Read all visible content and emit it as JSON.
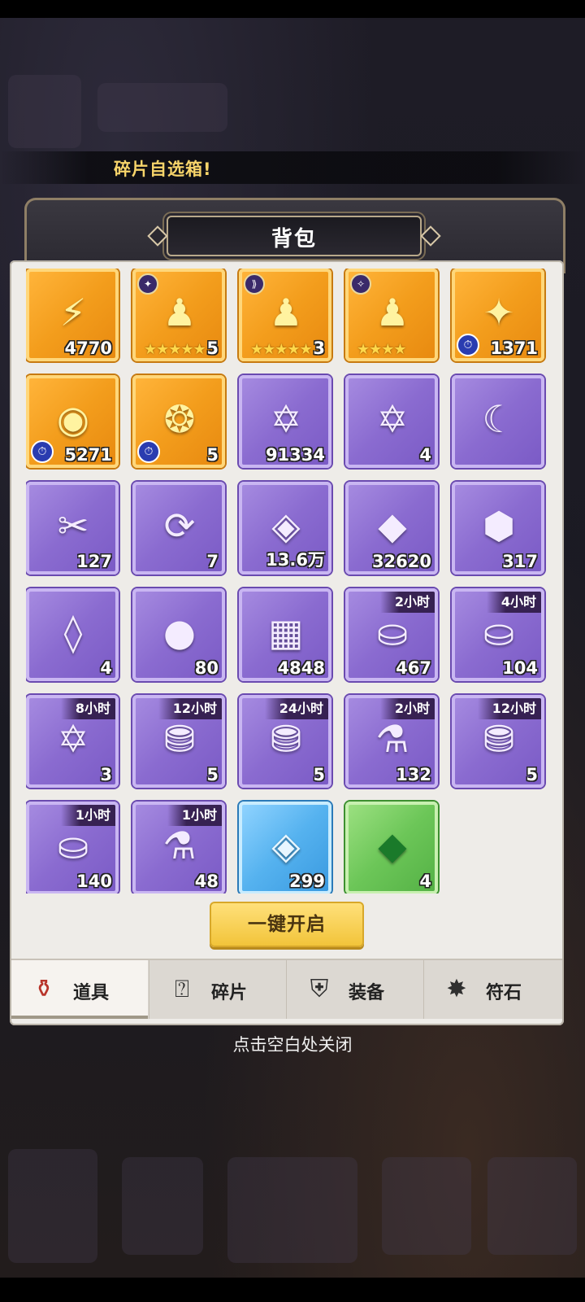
{
  "marquee_text": "碎片自选箱!",
  "panel": {
    "title": "背包"
  },
  "items": [
    {
      "rarity": "gold",
      "icon": "yellow-crystal-icon",
      "glyph": "⚡",
      "count": "4770"
    },
    {
      "rarity": "gold",
      "icon": "hero-figure-icon",
      "glyph": "♟",
      "count": "5",
      "stars": "★★★★★",
      "badge": "✦"
    },
    {
      "rarity": "gold",
      "icon": "hero-figure-icon",
      "glyph": "♟",
      "count": "3",
      "stars": "★★★★★",
      "badge": "⟫"
    },
    {
      "rarity": "gold",
      "icon": "hero-figure-icon",
      "glyph": "♟",
      "count": "",
      "stars": "★★★★",
      "badge": "✧"
    },
    {
      "rarity": "gold",
      "icon": "star-emblem-icon",
      "glyph": "✦",
      "count": "1371",
      "timer": true
    },
    {
      "rarity": "gold",
      "icon": "crystal-ball-icon",
      "glyph": "◉",
      "count": "5271",
      "timer": true
    },
    {
      "rarity": "gold",
      "icon": "dragon-egg-icon",
      "glyph": "❂",
      "count": "5",
      "timer": true
    },
    {
      "rarity": "purple",
      "icon": "star-coin-icon",
      "glyph": "✡",
      "count": "91334"
    },
    {
      "rarity": "purple",
      "icon": "hexagram-book-icon",
      "glyph": "✡",
      "count": "4"
    },
    {
      "rarity": "purple",
      "icon": "moon-charm-icon",
      "glyph": "☾",
      "count": ""
    },
    {
      "rarity": "purple",
      "icon": "red-ticket-icon",
      "glyph": "✂",
      "count": "127"
    },
    {
      "rarity": "purple",
      "icon": "refresh-scroll-icon",
      "glyph": "⟳",
      "count": "7"
    },
    {
      "rarity": "purple",
      "icon": "blue-gem-icon",
      "glyph": "◈",
      "count": "13.6万"
    },
    {
      "rarity": "purple",
      "icon": "blue-crystal-icon",
      "glyph": "◆",
      "count": "32620"
    },
    {
      "rarity": "purple",
      "icon": "purple-gem-icon",
      "glyph": "⬢",
      "count": "317"
    },
    {
      "rarity": "purple",
      "icon": "rune-crystal-icon",
      "glyph": "◊",
      "count": "4"
    },
    {
      "rarity": "purple",
      "icon": "purple-orb-icon",
      "glyph": "●",
      "count": "80"
    },
    {
      "rarity": "purple",
      "icon": "gold-bars-icon",
      "glyph": "▦",
      "count": "4848"
    },
    {
      "rarity": "purple",
      "icon": "gold-coins-icon",
      "glyph": "⛀",
      "count": "467",
      "tag": "2小时"
    },
    {
      "rarity": "purple",
      "icon": "gold-coins-icon",
      "glyph": "⛀",
      "count": "104",
      "tag": "4小时"
    },
    {
      "rarity": "purple",
      "icon": "coin-bag-icon",
      "glyph": "✡",
      "count": "3",
      "tag": "8小时"
    },
    {
      "rarity": "purple",
      "icon": "treasure-chest-icon",
      "glyph": "⛃",
      "count": "5",
      "tag": "12小时"
    },
    {
      "rarity": "purple",
      "icon": "treasure-chest-icon",
      "glyph": "⛃",
      "count": "5",
      "tag": "24小时"
    },
    {
      "rarity": "purple",
      "icon": "potion-bottles-icon",
      "glyph": "⚗",
      "count": "132",
      "tag": "2小时"
    },
    {
      "rarity": "purple",
      "icon": "potion-chest-icon",
      "glyph": "⛃",
      "count": "5",
      "tag": "12小时"
    },
    {
      "rarity": "purple",
      "icon": "gold-coins-icon",
      "glyph": "⛀",
      "count": "140",
      "tag": "1小时"
    },
    {
      "rarity": "purple",
      "icon": "potion-bottles-icon",
      "glyph": "⚗",
      "count": "48",
      "tag": "1小时"
    },
    {
      "rarity": "blue",
      "icon": "blue-sapphire-icon",
      "glyph": "◈",
      "count": "299"
    },
    {
      "rarity": "green",
      "icon": "green-emerald-icon",
      "glyph": "◆",
      "count": "4"
    }
  ],
  "open_all_label": "一键开启",
  "tabs": [
    {
      "label": "道具",
      "icon": "potion-icon",
      "glyph": "⚱",
      "active": true
    },
    {
      "label": "碎片",
      "icon": "question-card-icon",
      "glyph": "⍰",
      "active": false
    },
    {
      "label": "装备",
      "icon": "shield-icon",
      "glyph": "⛨",
      "active": false
    },
    {
      "label": "符石",
      "icon": "rune-star-icon",
      "glyph": "✸",
      "active": false
    }
  ],
  "close_hint": "点击空白处关闭",
  "colors": {
    "gold_slot": "#f39d1c",
    "purple_slot": "#8a6bd0",
    "blue_slot": "#55b2ef",
    "green_slot": "#6cc658",
    "open_button": "#f2c43a"
  }
}
